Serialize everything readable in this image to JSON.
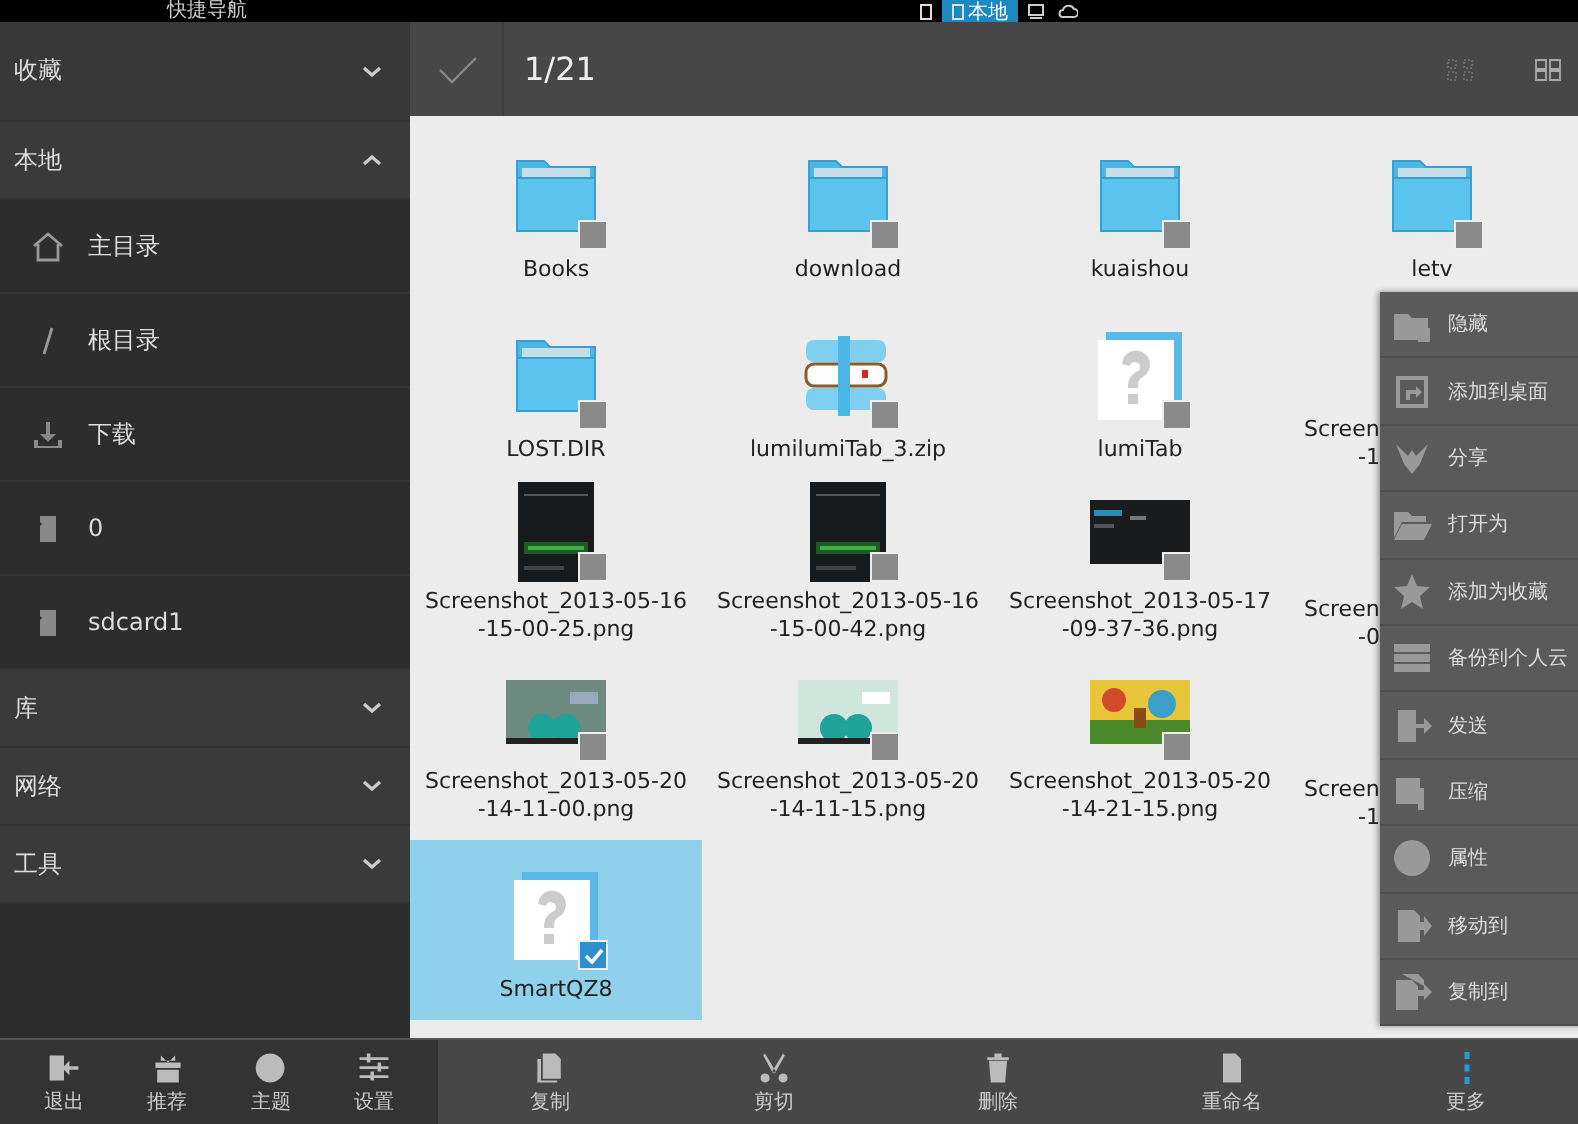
{
  "top_bar": {
    "title": "快捷导航",
    "tabs": [
      {
        "kind": "phone",
        "selected": false
      },
      {
        "kind": "phone",
        "label": "本地",
        "selected": true
      },
      {
        "kind": "computer",
        "selected": false
      },
      {
        "kind": "cloud",
        "selected": false
      }
    ]
  },
  "sidebar": {
    "sections": [
      {
        "label": "收藏",
        "expanded": false
      },
      {
        "label": "本地",
        "expanded": true,
        "children": [
          {
            "kind": "home",
            "label": "主目录"
          },
          {
            "kind": "root",
            "label": "根目录"
          },
          {
            "kind": "download",
            "label": "下载"
          },
          {
            "kind": "sdcard",
            "label": "0"
          },
          {
            "kind": "sdcard",
            "label": "sdcard1"
          }
        ]
      },
      {
        "label": "库",
        "expanded": false
      },
      {
        "label": "网络",
        "expanded": false
      },
      {
        "label": "工具",
        "expanded": false
      }
    ],
    "tools": [
      "退出",
      "推荐",
      "主题",
      "设置"
    ]
  },
  "toolbar": {
    "count": "1/21"
  },
  "files": [
    {
      "kind": "folder",
      "lines": [
        "Books"
      ],
      "checked": false,
      "selected": false
    },
    {
      "kind": "folder",
      "lines": [
        "download"
      ],
      "checked": false,
      "selected": false
    },
    {
      "kind": "folder",
      "lines": [
        "kuaishou"
      ],
      "checked": false,
      "selected": false
    },
    {
      "kind": "folder",
      "lines": [
        "letv"
      ],
      "checked": false,
      "selected": false
    },
    {
      "kind": "folder",
      "lines": [
        "LOST.DIR"
      ],
      "checked": false,
      "selected": false
    },
    {
      "kind": "zip",
      "lines": [
        "lumilumiTab_3.zip"
      ],
      "checked": false,
      "selected": false
    },
    {
      "kind": "unknown",
      "lines": [
        "lumiTab"
      ],
      "checked": false,
      "selected": false
    },
    {
      "kind": "partial",
      "lines": [
        "Screen",
        "-1"
      ]
    },
    {
      "kind": "picture",
      "lines": [
        "Screenshot_2013-05-16",
        "-15-00-25.png"
      ],
      "checked": false,
      "selected": false
    },
    {
      "kind": "picture",
      "lines": [
        "Screenshot_2013-05-16",
        "-15-00-42.png"
      ],
      "checked": false,
      "selected": false
    },
    {
      "kind": "picture",
      "lines": [
        "Screenshot_2013-05-17",
        "-09-37-36.png"
      ],
      "checked": false,
      "selected": false
    },
    {
      "kind": "partial",
      "lines": [
        "Screen",
        "-0"
      ]
    },
    {
      "kind": "picture",
      "lines": [
        "Screenshot_2013-05-20",
        "-14-11-00.png"
      ],
      "checked": false,
      "selected": false
    },
    {
      "kind": "picture",
      "lines": [
        "Screenshot_2013-05-20",
        "-14-11-15.png"
      ],
      "checked": false,
      "selected": false
    },
    {
      "kind": "picture",
      "lines": [
        "Screenshot_2013-05-20",
        "-14-21-15.png"
      ],
      "checked": false,
      "selected": false
    },
    {
      "kind": "partial",
      "lines": [
        "Screen",
        "-1"
      ]
    },
    {
      "kind": "unknown",
      "lines": [
        "SmartQZ8"
      ],
      "checked": true,
      "selected": true
    }
  ],
  "menu": [
    "隐藏",
    "添加到桌面",
    "分享",
    "打开为",
    "添加为收藏",
    "备份到个人云",
    "发送",
    "压缩",
    "属性",
    "移动到",
    "复制到"
  ],
  "actions": [
    "复制",
    "剪切",
    "删除",
    "重命名",
    "更多"
  ]
}
